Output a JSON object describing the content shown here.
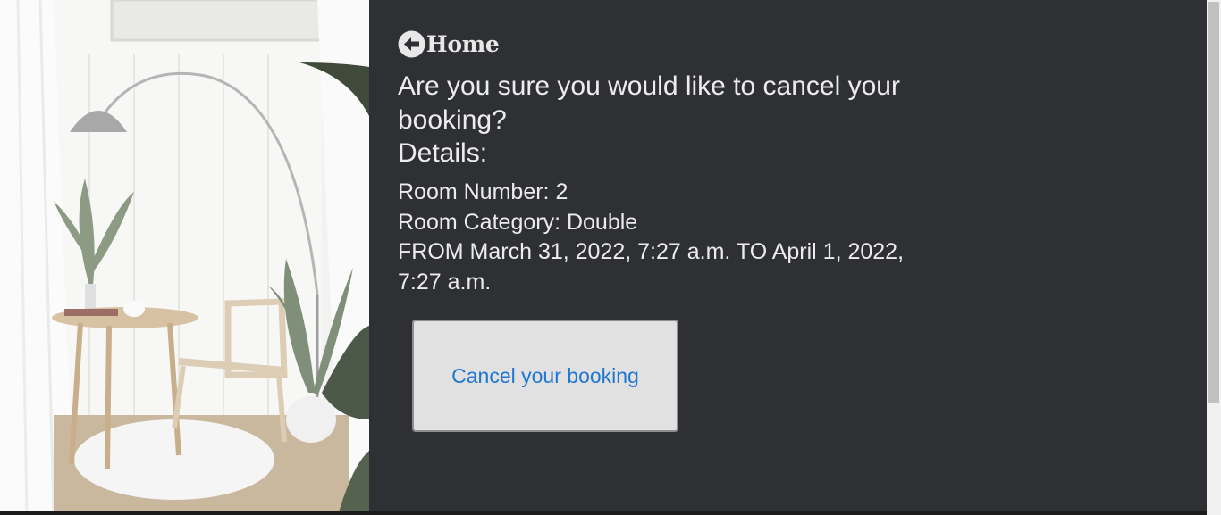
{
  "nav": {
    "home_icon": "circle-arrow-left-icon",
    "home_label": "Home"
  },
  "main": {
    "question": "Are you sure you would like to cancel your booking?",
    "details_heading": "Details:",
    "details": {
      "room_number": "Room Number: 2",
      "room_category": "Room Category: Double",
      "date_range": "FROM March 31, 2022, 7:27 a.m. TO April 1, 2022, 7:27 a.m."
    },
    "cancel_button_label": "Cancel your booking"
  },
  "colors": {
    "background": "#2f3033",
    "text": "#ececec",
    "button_bg": "#e1e1e1",
    "button_text": "#1f76d1"
  }
}
